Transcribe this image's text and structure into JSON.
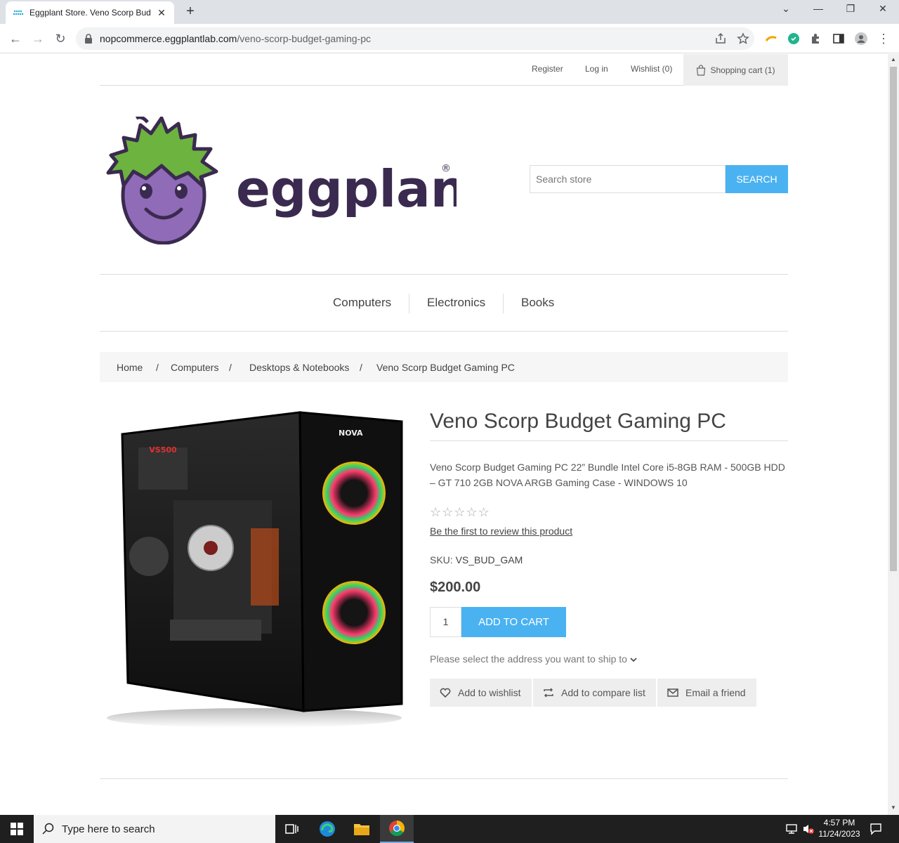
{
  "browser": {
    "tab_title": "Eggplant Store. Veno Scorp Bud",
    "url_host": "nopcommerce.eggplantlab.com",
    "url_path": "/veno-scorp-budget-gaming-pc"
  },
  "header": {
    "register": "Register",
    "login": "Log in",
    "wishlist": "Wishlist (0)",
    "cart": "Shopping cart (1)"
  },
  "logo": {
    "text": "eggplant",
    "mark": "®"
  },
  "search": {
    "placeholder": "Search store",
    "button": "SEARCH"
  },
  "menu": [
    "Computers",
    "Electronics",
    "Books"
  ],
  "breadcrumb": {
    "home": "Home",
    "sep": "/",
    "computers": "Computers",
    "desktops": "Desktops & Notebooks",
    "current": "Veno Scorp Budget Gaming PC"
  },
  "product": {
    "title": "Veno Scorp Budget Gaming PC",
    "description": "Veno Scorp Budget Gaming PC 22” Bundle Intel Core i5-8GB RAM - 500GB HDD – GT 710 2GB NOVA ARGB Gaming Case - WINDOWS 10",
    "rating": 0,
    "rating_max": 5,
    "review_link": "Be the first to review this product",
    "sku_label": "SKU:",
    "sku": "VS_BUD_GAM",
    "price": "$200.00",
    "quantity": "1",
    "add_to_cart": "ADD TO CART",
    "ship_prompt": "Please select the address you want to ship to",
    "wishlist_btn": "Add to wishlist",
    "compare_btn": "Add to compare list",
    "email_btn": "Email a friend",
    "case_brand": "NOVA",
    "psu_label": "VS500"
  },
  "taskbar": {
    "search_placeholder": "Type here to search",
    "time": "4:57 PM",
    "date": "11/24/2023"
  },
  "colors": {
    "accent": "#4ab2f1",
    "brand_purple": "#3b2a4f",
    "brand_green": "#6cb33f"
  }
}
